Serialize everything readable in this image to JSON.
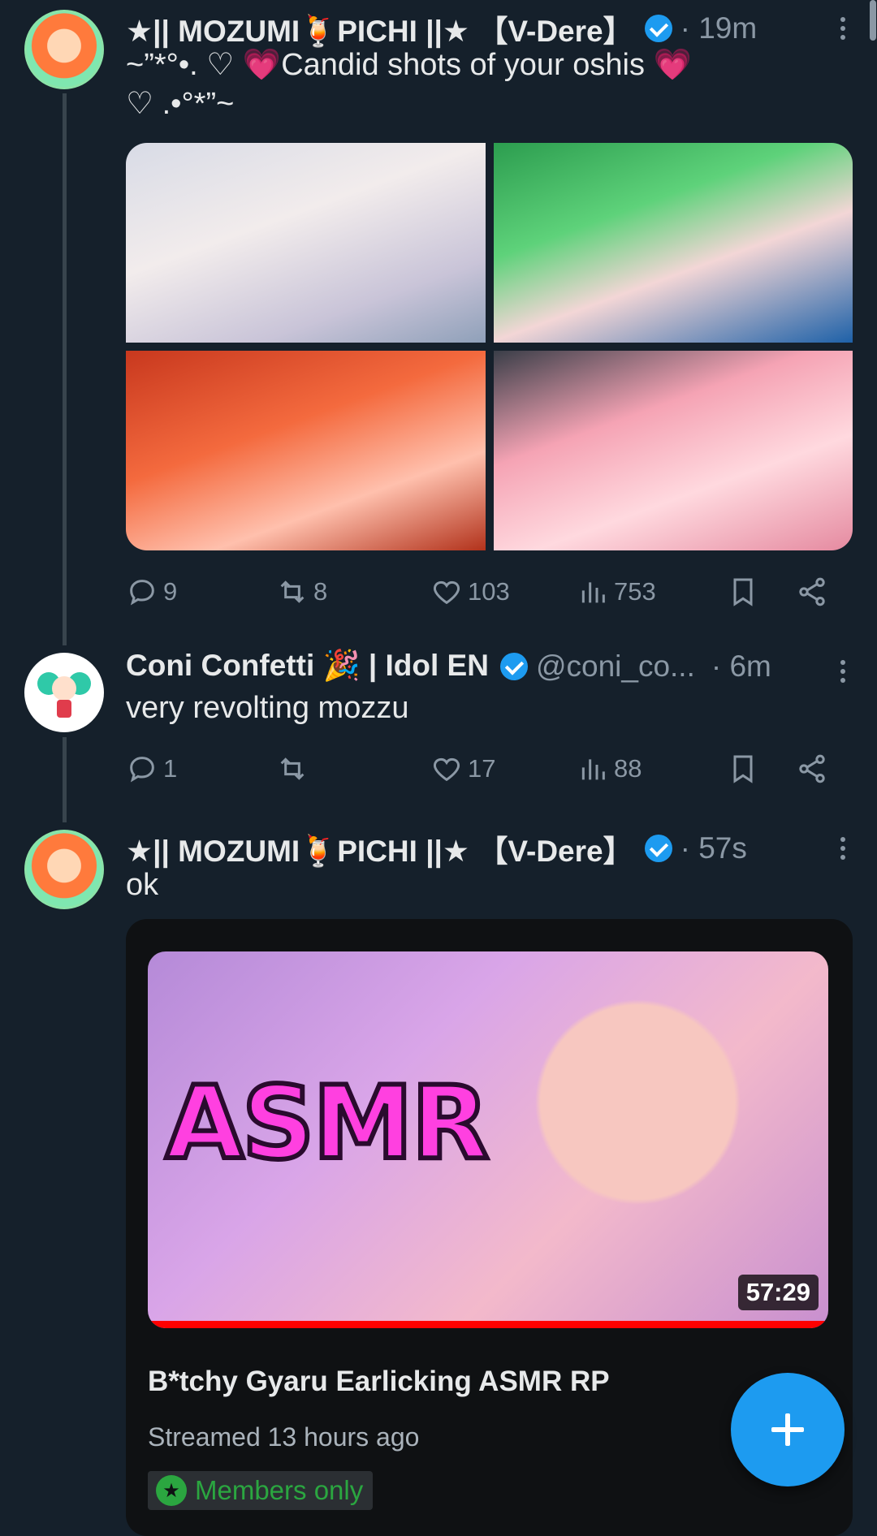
{
  "tweets": [
    {
      "author_name": "★|| MOZUMI🍹PICHI ||★ 【V-Dere】",
      "time": "· 19m",
      "text_line1": "~”*°•. ♡ 💗Candid shots of your oshis 💗",
      "text_line2": "♡ .•°*”~",
      "replies": "9",
      "reposts": "8",
      "likes": "103",
      "views": "753"
    },
    {
      "author_name": "Coni Confetti 🎉 | Idol EN",
      "handle": "@coni_co...",
      "time": "· 6m",
      "text": "very revolting mozzu",
      "replies": "1",
      "reposts": "",
      "likes": "17",
      "views": "88"
    },
    {
      "author_name": "★|| MOZUMI🍹PICHI ||★ 【V-Dere】",
      "time": "· 57s",
      "text": "ok",
      "card": {
        "thumb_text": "ASMR",
        "duration": "57:29",
        "title": "B*tchy Gyaru Earlicking ASMR RP",
        "subtitle": "Streamed 13 hours ago",
        "badge": "Members only"
      }
    }
  ],
  "icons": {
    "reply": "reply-icon",
    "repost": "repost-icon",
    "like": "heart-icon",
    "views": "views-icon",
    "bookmark": "bookmark-icon",
    "share": "share-icon",
    "compose": "plus-icon"
  },
  "colors": {
    "background": "#15202b",
    "accent": "#1d9bf0",
    "muted": "#8b98a5",
    "members_green": "#2ba640"
  }
}
